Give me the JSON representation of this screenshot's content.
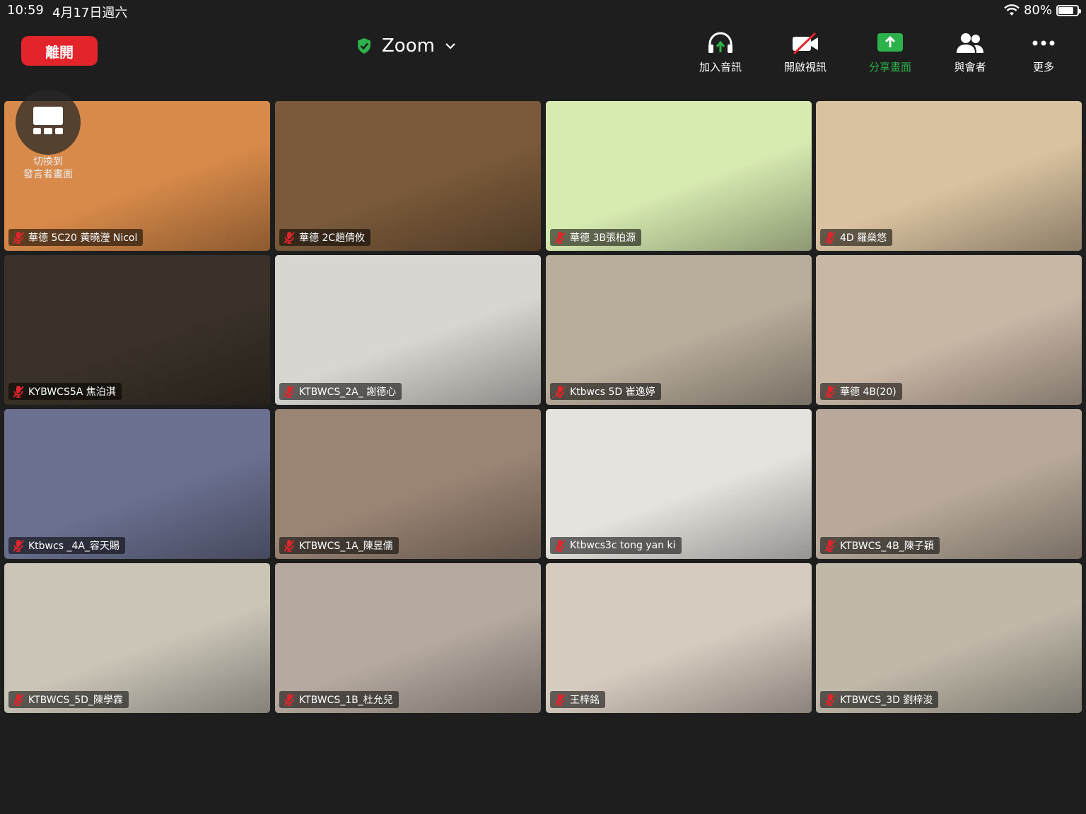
{
  "status_bar": {
    "time": "10:59",
    "date": "4月17日週六",
    "battery": "80%",
    "battery_level": 0.8
  },
  "header": {
    "leave_label": "離開",
    "meeting_title": "Zoom",
    "toolbar": {
      "join_audio": "加入音訊",
      "start_video": "開啟視訊",
      "share_screen": "分享畫面",
      "participants": "與會者",
      "more": "更多"
    }
  },
  "switch_view_label": "切換到\n發言者畫面",
  "participants": [
    {
      "name": "華德 5C20 黃曉瀅 Nicol",
      "muted": true,
      "bg": "#d88a4a"
    },
    {
      "name": "華德  2C趙倩攸",
      "muted": true,
      "bg": "#7a5a3a"
    },
    {
      "name": "華德 3B張柏源",
      "muted": true,
      "bg": "#d7eab0"
    },
    {
      "name": "4D 羅燊悠",
      "muted": true,
      "bg": "#d9c2a0"
    },
    {
      "name": "KYBWCS5A 焦泊淇",
      "muted": true,
      "bg": "#3a3228"
    },
    {
      "name": "KTBWCS_2A_ 謝德心",
      "muted": true,
      "bg": "#d8d6d0"
    },
    {
      "name": "Ktbwcs 5D 崔逸婷",
      "muted": true,
      "bg": "#b9ad9c"
    },
    {
      "name": "華德 4B(20)",
      "muted": true,
      "bg": "#c9b7a6"
    },
    {
      "name": "Ktbwcs _4A_容天賜",
      "muted": true,
      "bg": "#6b7090"
    },
    {
      "name": "KTBWCS_1A_陳昱儒",
      "muted": true,
      "bg": "#9a8474"
    },
    {
      "name": "Ktbwcs3c tong yan ki",
      "muted": true,
      "bg": "#e6e3de"
    },
    {
      "name": "KTBWCS_4B_陳子穎",
      "muted": true,
      "bg": "#b8a99a"
    },
    {
      "name": "KTBWCS_5D_陳學霖",
      "muted": true,
      "bg": "#cbc5b8"
    },
    {
      "name": "KTBWCS_1B_杜允兒",
      "muted": true,
      "bg": "#b6aaa0"
    },
    {
      "name": "王梓銘",
      "muted": true,
      "bg": "#d6cbbf"
    },
    {
      "name": "KTBWCS_3D 劉梓浚",
      "muted": true,
      "bg": "#c0b9aa"
    }
  ]
}
